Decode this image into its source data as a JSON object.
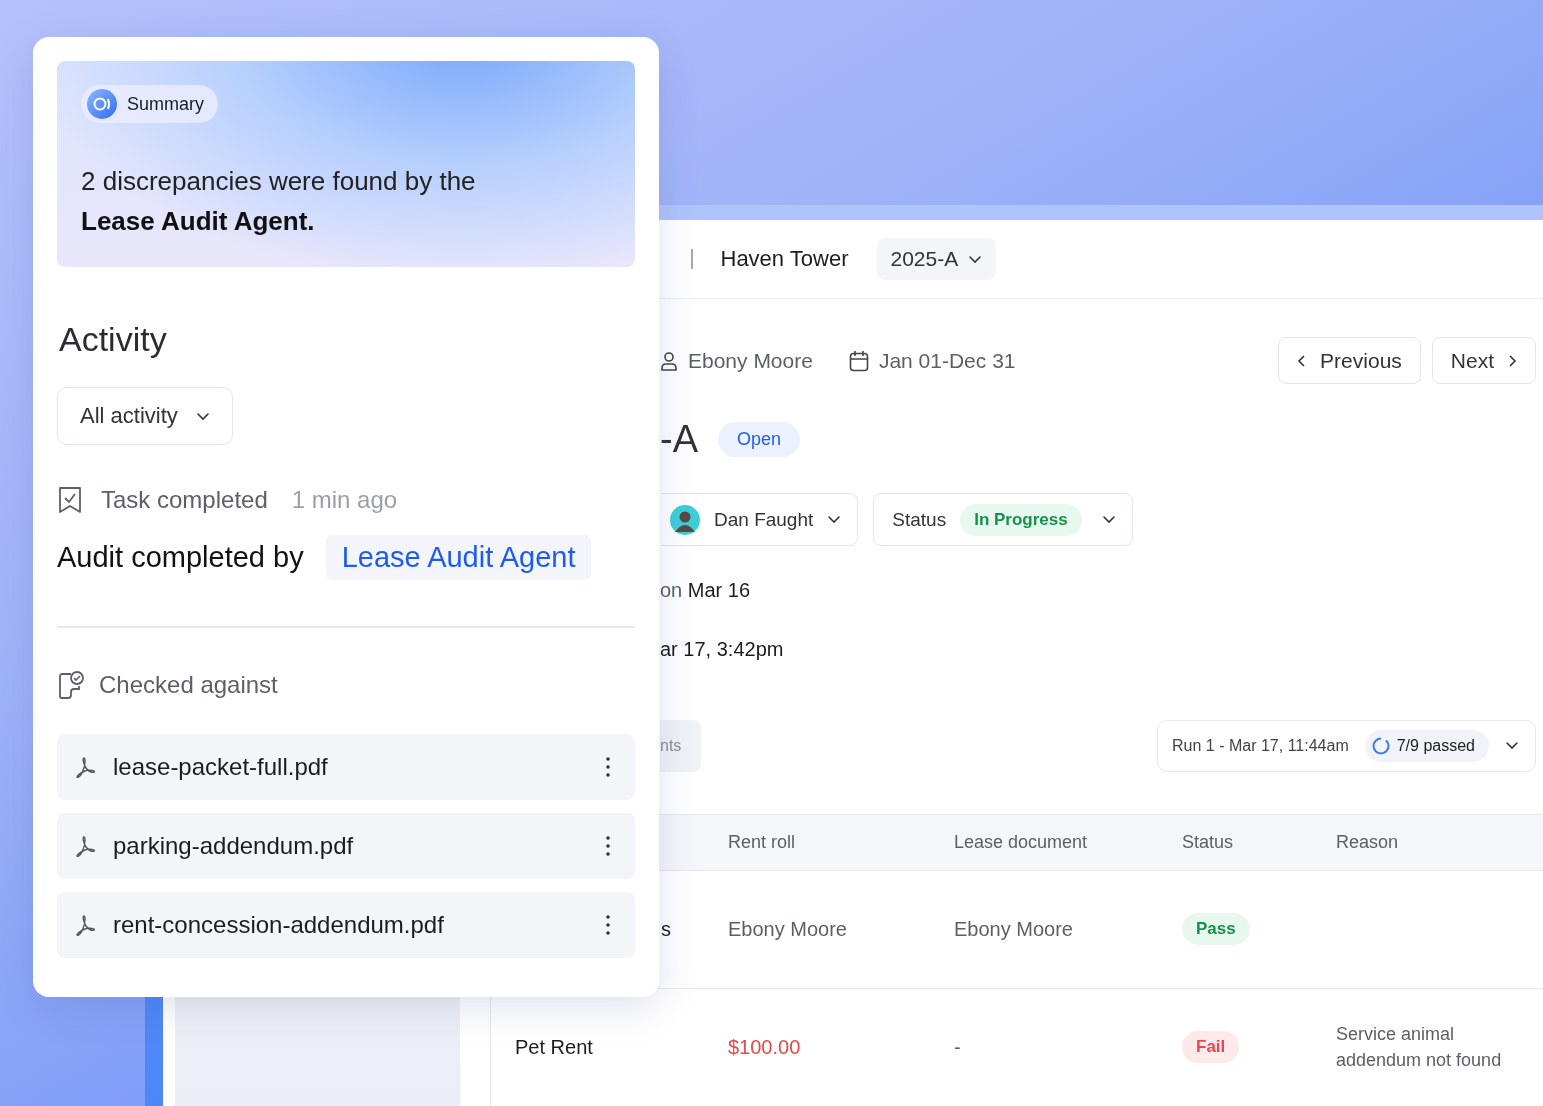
{
  "summary": {
    "badge": "Summary",
    "text": "2 discrepancies were found by the **Lease Audit Agent.**"
  },
  "activity": {
    "title": "Activity",
    "filter": "All activity",
    "event": {
      "label": "Task completed",
      "time": "1 min ago"
    },
    "audit": {
      "label": "Audit completed by",
      "agent": "Lease Audit Agent"
    },
    "checked_against": {
      "label": "Checked against",
      "files": [
        {
          "name": "lease-packet-full.pdf"
        },
        {
          "name": "parking-addendum.pdf"
        },
        {
          "name": "rent-concession-addendum.pdf"
        }
      ]
    }
  },
  "record": {
    "property": "Haven Tower",
    "period": "2025-A",
    "tenant": "Ebony Moore",
    "date_range": "Jan 01-Dec 31",
    "previous": "Previous",
    "next": "Next",
    "title": "-A",
    "badge": "Open",
    "assignee": "Dan Faught",
    "status_label": "Status",
    "status_value": "In Progress",
    "line_1": "on **Mar 16**",
    "line_2": "ar 17, 3:42pm",
    "tab": "nts",
    "run": {
      "label": "Run 1 - Mar 17, 11:44am",
      "result": "7/9 passed"
    }
  },
  "table": {
    "columns": [
      "Rent roll",
      "Lease document",
      "Status",
      "Reason"
    ],
    "rows": [
      {
        "column_1": "s",
        "rent_roll": "Ebony Moore",
        "lease_document": "Ebony Moore",
        "status": "Pass",
        "kind": "pass"
      },
      {
        "column_1": "Pet Rent",
        "rent_roll": "$100.00",
        "lease_document": "-",
        "status": "Fail",
        "kind": "fail",
        "reason": "Service animal addendum not found"
      }
    ]
  }
}
